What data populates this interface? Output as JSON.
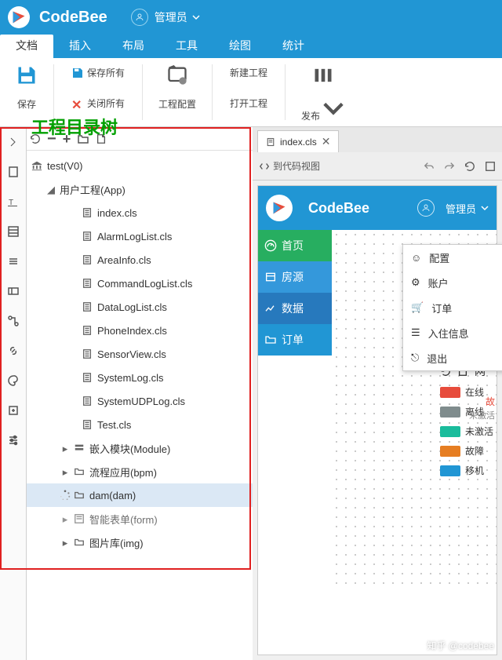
{
  "header": {
    "app_name": "CodeBee",
    "user_name": "管理员"
  },
  "menu": {
    "tabs": [
      "文档",
      "插入",
      "布局",
      "工具",
      "绘图",
      "统计"
    ],
    "active": 0
  },
  "ribbon": {
    "save": "保存",
    "save_all": "保存所有",
    "close_all": "关闭所有",
    "proj_config": "工程配置",
    "new_proj": "新建工程",
    "open_proj": "打开工程",
    "publish": "发布"
  },
  "annotation": "工程目录树",
  "tree": {
    "root": "test(V0)",
    "app": "用户工程(App)",
    "files": [
      "index.cls",
      "AlarmLogList.cls",
      "AreaInfo.cls",
      "CommandLogList.cls",
      "DataLogList.cls",
      "PhoneIndex.cls",
      "SensorView.cls",
      "SystemLog.cls",
      "SystemUDPLog.cls",
      "Test.cls"
    ],
    "module": "嵌入模块(Module)",
    "bpm": "流程应用(bpm)",
    "dam": "dam(dam)",
    "form": "智能表单(form)",
    "img": "图片库(img)"
  },
  "editor": {
    "tab_label": "index.cls",
    "to_code_view": "到代码视图"
  },
  "preview": {
    "title": "CodeBee",
    "user": "管理员",
    "nav": {
      "home": "首页",
      "fang": "房源",
      "data": "数据",
      "order": "订单"
    },
    "menu": {
      "config": "配置",
      "account": "账户",
      "order": "订单",
      "checkin": "入住信息",
      "exit": "退出"
    },
    "legend_header": "网",
    "legend": [
      {
        "label": "在线",
        "color": "#e74c3c"
      },
      {
        "label": "离线",
        "color": "#7f8c8d"
      },
      {
        "label": "未激活",
        "color": "#1abc9c"
      },
      {
        "label": "故障",
        "color": "#e67e22"
      },
      {
        "label": "移机",
        "color": "#2196D4"
      }
    ],
    "side_label1": "故",
    "side_label2": "未激活"
  },
  "watermark": "知乎 @codebee"
}
